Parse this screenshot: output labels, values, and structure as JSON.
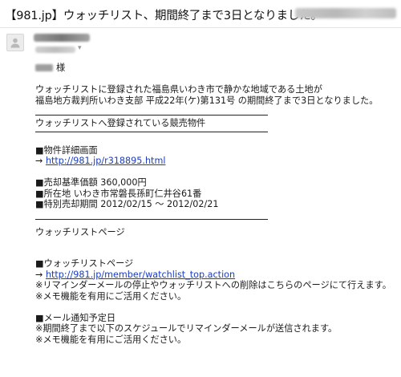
{
  "email": {
    "subject": "【981.jp】ウォッチリスト、期間終了まで3日となりました。",
    "greeting_suffix": "様",
    "intro_line1": "ウォッチリストに登録された福島県いわき市で静かな地域である土地が",
    "intro_line2": "福島地方裁判所いわき支部  平成22年(ケ)第131号  の期間終了まで3日となりました。",
    "section_title": "ウォッチリストへ登録されている競売物件",
    "detail_label": "■物件詳細画面",
    "detail_arrow": "→",
    "detail_link": "http://981.jp/r318895.html",
    "price_line": "■売却基準価額  360,000円",
    "address_line": "■所在地  いわき市常磐長孫町仁井谷61番",
    "period_line": "■特別売却期間  2012/02/15 ～ 2012/02/21",
    "watchlist_heading": "ウォッチリストページ",
    "watchlist_label": "■ウォッチリストページ",
    "watchlist_arrow": "→",
    "watchlist_link": "http://981.jp/member/watchlist_top.action",
    "reminder_line1": "※リマインダーメールの停止やウォッチリストへの削除はこちらのページにて行えます。",
    "reminder_line2": "※メモ機能を有用にご活用ください。",
    "schedule_label": "■メール通知予定日",
    "schedule_line1": "※期間終了まで以下のスケジュールでリマインダーメールが送信されます。",
    "schedule_line2": "※メモ機能を有用にご活用ください。"
  },
  "icons": {
    "avatar": "person-icon",
    "recipient_toggle": "chevron-down-icon"
  }
}
